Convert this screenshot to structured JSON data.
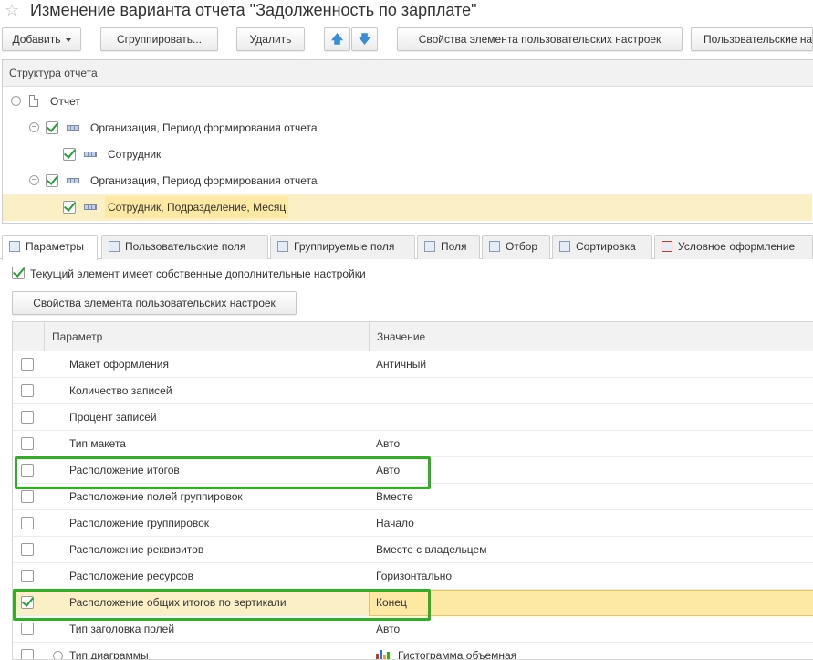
{
  "window": {
    "title": "Изменение варианта отчета \"Задолженность по зарплате\""
  },
  "toolbar": {
    "add": "Добавить",
    "group": "Сгруппировать...",
    "delete": "Удалить",
    "element_properties": "Свойства элемента пользовательских настроек",
    "user_settings": "Пользовательские настройки"
  },
  "structure": {
    "header": "Структура отчета",
    "items": [
      {
        "label": "Отчет"
      },
      {
        "label": "Организация, Период формирования отчета",
        "checked": true
      },
      {
        "label": "Сотрудник",
        "checked": true
      },
      {
        "label": "Организация, Период формирования отчета",
        "checked": true
      },
      {
        "label": "Сотрудник, Подразделение, Месяц",
        "checked": true,
        "selected": true
      }
    ]
  },
  "tabs": [
    {
      "label": "Параметры",
      "active": true
    },
    {
      "label": "Пользовательские поля"
    },
    {
      "label": "Группируемые поля"
    },
    {
      "label": "Поля"
    },
    {
      "label": "Отбор"
    },
    {
      "label": "Сортировка"
    },
    {
      "label": "Условное оформление"
    }
  ],
  "own_settings": {
    "label": "Текущий элемент имеет собственные дополнительные настройки",
    "checked": true
  },
  "element_properties_button": "Свойства элемента пользовательских настроек",
  "params_table": {
    "columns": [
      "Параметр",
      "Значение"
    ],
    "rows": [
      {
        "name": "Макет оформления",
        "value": "Античный",
        "checked": false
      },
      {
        "name": "Количество записей",
        "value": "",
        "checked": false
      },
      {
        "name": "Процент записей",
        "value": "",
        "checked": false
      },
      {
        "name": "Тип макета",
        "value": "Авто",
        "checked": false
      },
      {
        "name": "Расположение итогов",
        "value": "Авто",
        "checked": false,
        "highlighted": true
      },
      {
        "name": "Расположение полей группировок",
        "value": "Вместе",
        "checked": false
      },
      {
        "name": "Расположение группировок",
        "value": "Начало",
        "checked": false
      },
      {
        "name": "Расположение реквизитов",
        "value": "Вместе с владельцем",
        "checked": false
      },
      {
        "name": "Расположение ресурсов",
        "value": "Горизонтально",
        "checked": false
      },
      {
        "name": "Расположение общих итогов по вертикали",
        "value": "Конец",
        "checked": true,
        "selected": true,
        "highlighted": true
      },
      {
        "name": "Тип заголовка полей",
        "value": "Авто",
        "checked": false
      },
      {
        "name": "Тип диаграммы",
        "value": "Гистограмма объемная",
        "checked": false,
        "expandable": true
      }
    ]
  },
  "colors": {
    "highlight_frame": "#2db021",
    "selection": "#fbf0c5",
    "checkmark": "#2a9d3b",
    "arrow_buttons": "#3a8ed8"
  }
}
